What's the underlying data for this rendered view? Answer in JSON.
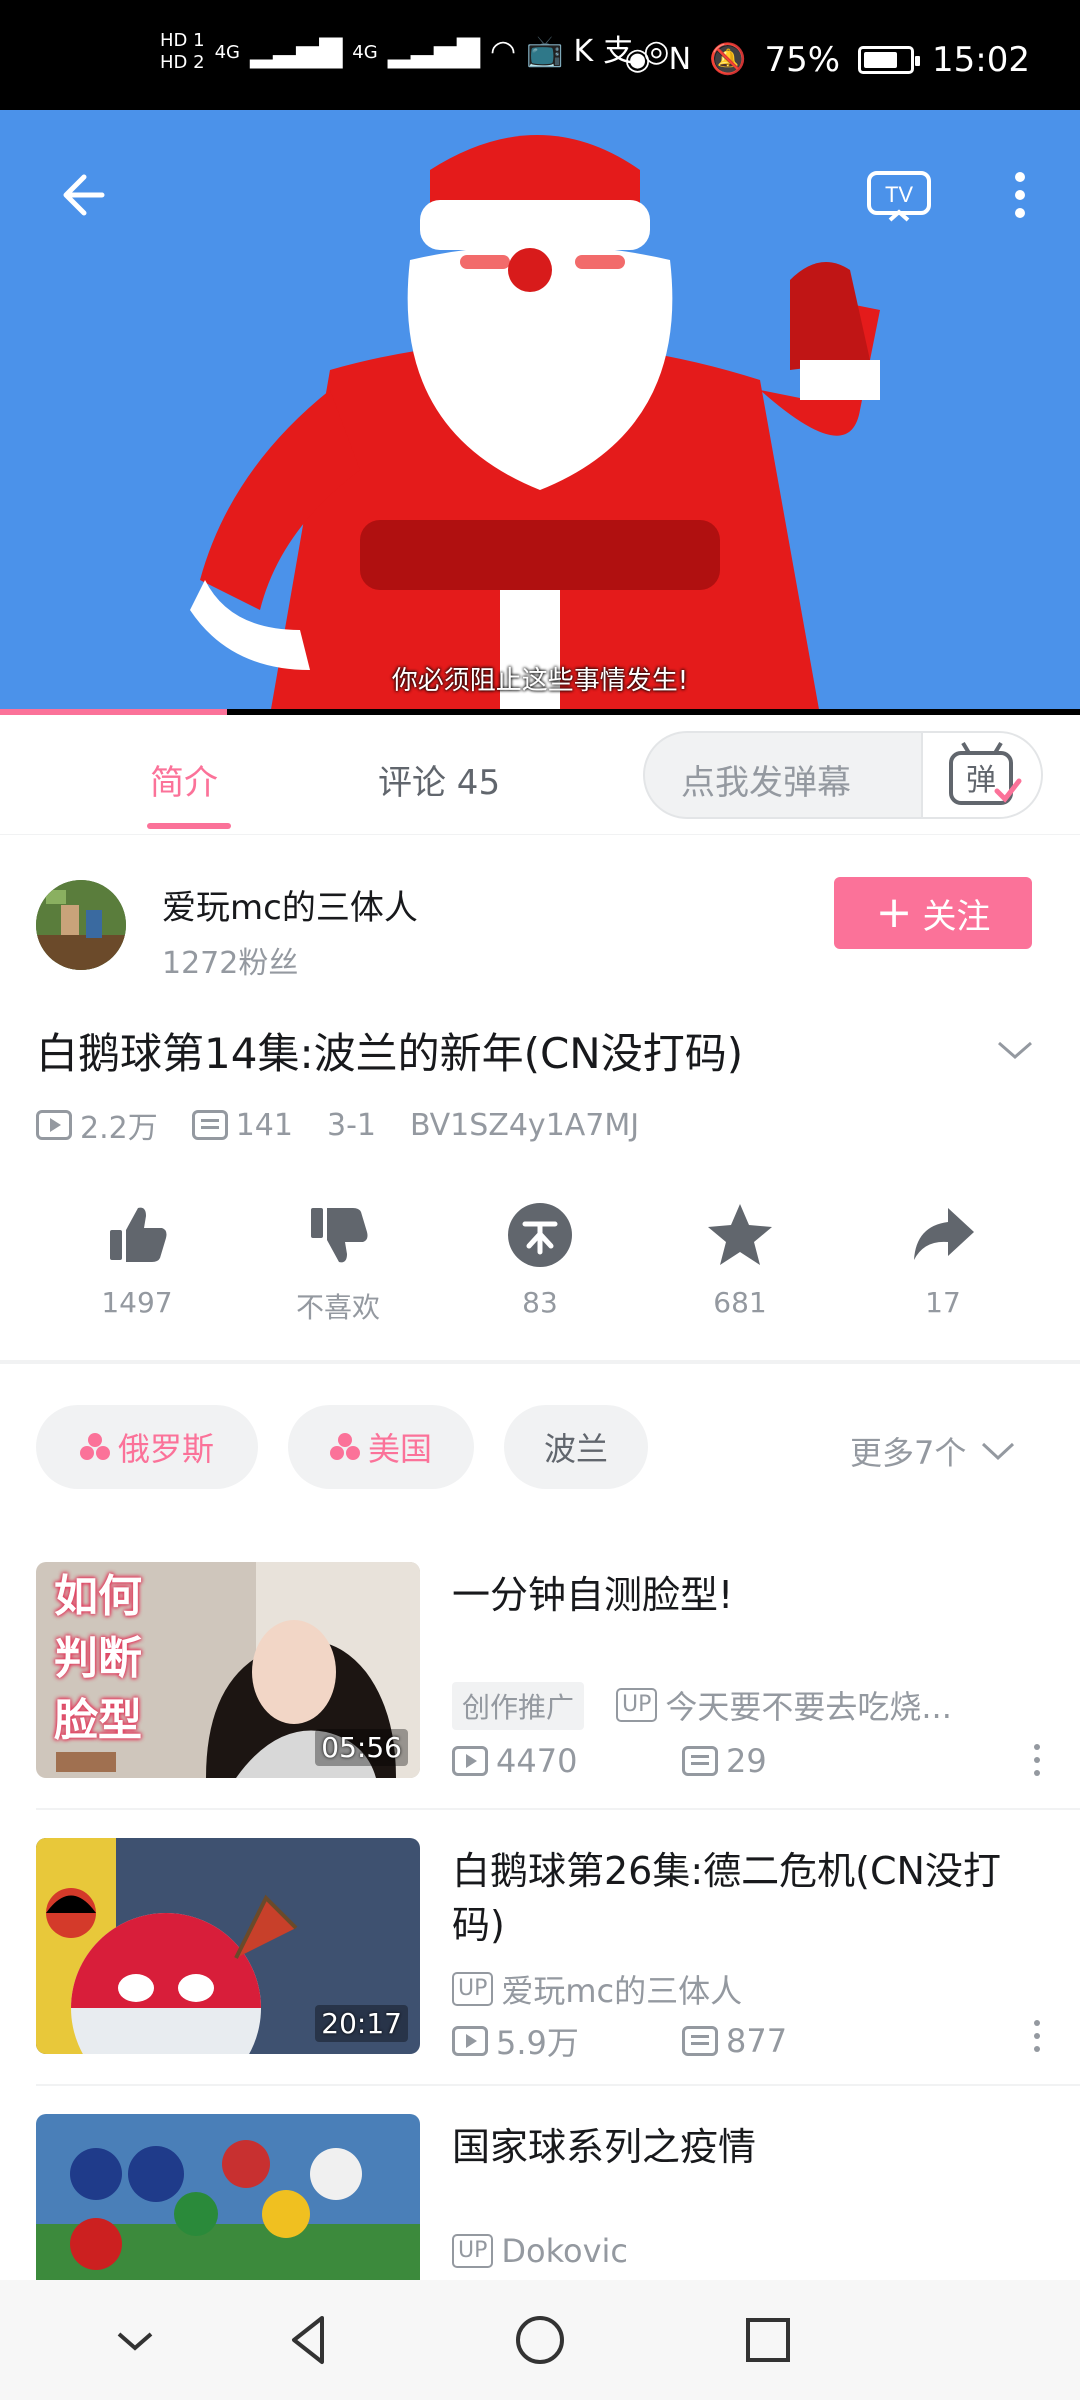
{
  "status_bar": {
    "signal_label_1": "HD 1",
    "signal_label_2": "HD 2",
    "network": "4G",
    "battery": "75%",
    "time": "15:02"
  },
  "video": {
    "subtitle": "你必须阻止这些事情发生!",
    "progress": 0.21,
    "cast_label": "TV"
  },
  "tabs": {
    "intro": "简介",
    "comments": "评论 45",
    "danmaku_placeholder": "点我发弹幕",
    "danmaku_button": "弹"
  },
  "uploader": {
    "name": "爱玩mc的三体人",
    "fans": "1272粉丝",
    "follow_label": "关注"
  },
  "video_info": {
    "title": "白鹅球第14集:波兰的新年(CN没打码)",
    "views": "2.2万",
    "danmaku_count": "141",
    "date": "3-1",
    "bvid": "BV1SZ4y1A7MJ"
  },
  "actions": [
    {
      "name": "like",
      "label": "1497"
    },
    {
      "name": "dislike",
      "label": "不喜欢"
    },
    {
      "name": "coin",
      "label": "83"
    },
    {
      "name": "favorite",
      "label": "681"
    },
    {
      "name": "share",
      "label": "17"
    }
  ],
  "tags": {
    "items": [
      "俄罗斯",
      "美国",
      "波兰"
    ],
    "more": "更多7个"
  },
  "recommendations": [
    {
      "title": "一分钟自测脸型!",
      "thumb_text": [
        "如何",
        "判断",
        "脸型"
      ],
      "duration": "05:56",
      "promo": "创作推广",
      "up_badge": "UP",
      "uploader": "今天要不要去吃烧...",
      "views": "4470",
      "danmaku": "29"
    },
    {
      "title": "白鹅球第26集:德二危机(CN没打码)",
      "duration": "20:17",
      "up_badge": "UP",
      "uploader": "爱玩mc的三体人",
      "views": "5.9万",
      "danmaku": "877"
    },
    {
      "title": "国家球系列之疫情",
      "up_badge": "UP",
      "uploader": "Dokovic"
    }
  ],
  "colors": {
    "accent": "#fb7299",
    "video_bg": "#4b92ea",
    "muted": "#9499a0"
  }
}
